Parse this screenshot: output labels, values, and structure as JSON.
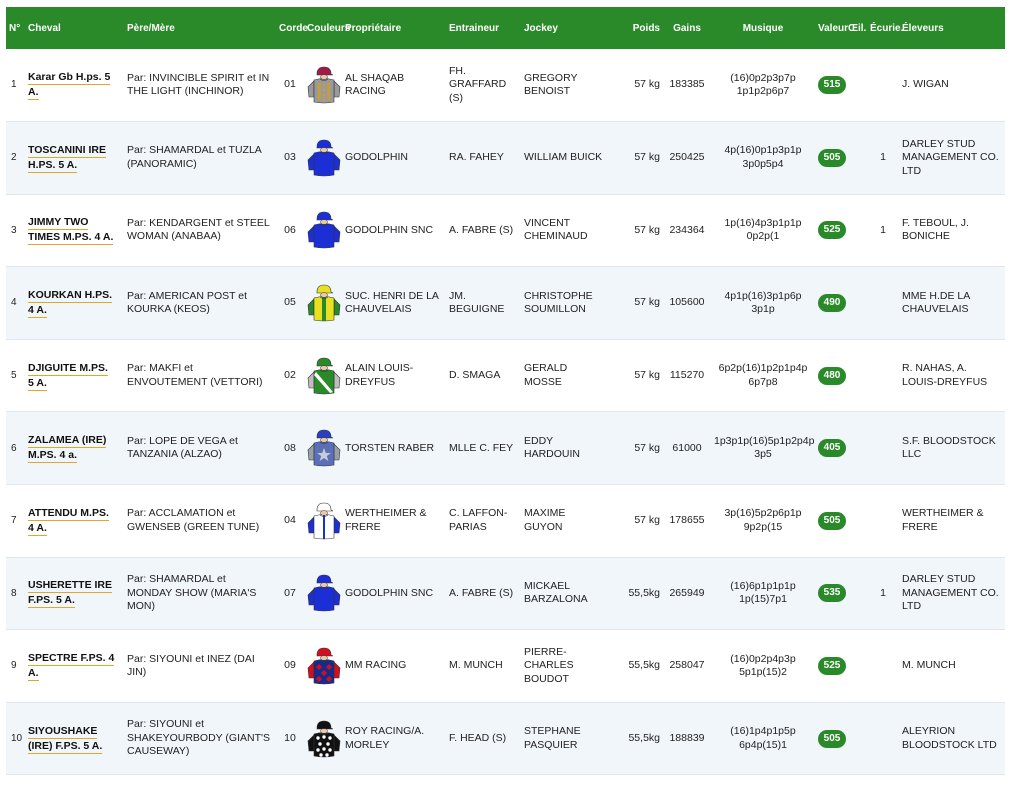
{
  "headers": {
    "num": "N°",
    "cheval": "Cheval",
    "pere_mere": "Père/Mère",
    "corde": "Corde",
    "couleurs": "Couleurs",
    "proprietaire": "Propriétaire",
    "entraineur": "Entraineur",
    "jockey": "Jockey",
    "poids": "Poids",
    "gains": "Gains",
    "musique": "Musique",
    "valeur": "Valeur",
    "oeil": "Œil.",
    "ecurie": "Écurie.",
    "eleveurs": "Éleveurs"
  },
  "runners": [
    {
      "num": "1",
      "cheval": "Karar Gb H.ps. 5 A.",
      "pere_mere": "Par: INVINCIBLE SPIRIT et IN THE LIGHT (INCHINOR)",
      "corde": "01",
      "jersey": "gold-grey-jersey",
      "cap": "#a11a4a",
      "body": "#9a9a9a",
      "sleeve": "#9a9a9a",
      "accent": "#c8a030",
      "pattern": "buttons",
      "proprietaire": "AL SHAQAB RACING",
      "entraineur": "FH. GRAFFARD (S)",
      "jockey": "GREGORY BENOIST",
      "poids": "57 kg",
      "gains": "183385",
      "musique": "(16)0p2p3p7p 1p1p2p6p7",
      "valeur": "515",
      "oeil": "",
      "ecurie": "",
      "eleveurs": "J. WIGAN"
    },
    {
      "num": "2",
      "cheval": "TOSCANINI IRE H.PS. 5 A.",
      "pere_mere": "Par: SHAMARDAL et TUZLA (PANORAMIC)",
      "corde": "03",
      "jersey": "royal-blue-jersey",
      "cap": "#1c2fd6",
      "body": "#1c2fd6",
      "sleeve": "#1c2fd6",
      "accent": "#1c2fd6",
      "pattern": "plain",
      "proprietaire": "GODOLPHIN",
      "entraineur": "RA. FAHEY",
      "jockey": "WILLIAM BUICK",
      "poids": "57 kg",
      "gains": "250425",
      "musique": "4p(16)0p1p3p1p 3p0p5p4",
      "valeur": "505",
      "oeil": "",
      "ecurie": "1",
      "eleveurs": "DARLEY STUD MANAGEMENT CO. LTD"
    },
    {
      "num": "3",
      "cheval": "JIMMY TWO TIMES M.PS. 4 A.",
      "pere_mere": "Par: KENDARGENT et STEEL WOMAN (ANABAA)",
      "corde": "06",
      "jersey": "royal-blue-jersey",
      "cap": "#1c2fd6",
      "body": "#1c2fd6",
      "sleeve": "#1c2fd6",
      "accent": "#1c2fd6",
      "pattern": "plain",
      "proprietaire": "GODOLPHIN SNC",
      "entraineur": "A. FABRE (S)",
      "jockey": "VINCENT CHEMINAUD",
      "poids": "57 kg",
      "gains": "234364",
      "musique": "1p(16)4p3p1p1p 0p2p(1",
      "valeur": "525",
      "oeil": "",
      "ecurie": "1",
      "eleveurs": "F. TEBOUL, J. BONICHE"
    },
    {
      "num": "4",
      "cheval": "KOURKAN H.PS. 4 A.",
      "pere_mere": "Par: AMERICAN POST et KOURKA (KEOS)",
      "corde": "05",
      "jersey": "yellow-green-jersey",
      "cap": "#e8e020",
      "body": "#e8e020",
      "sleeve": "#2a8a2a",
      "accent": "#2a8a2a",
      "pattern": "stripe",
      "proprietaire": "SUC. HENRI DE LA CHAUVELAIS",
      "entraineur": "JM. BEGUIGNE",
      "jockey": "CHRISTOPHE SOUMILLON",
      "poids": "57 kg",
      "gains": "105600",
      "musique": "4p1p(16)3p1p6p 3p1p",
      "valeur": "490",
      "oeil": "",
      "ecurie": "",
      "eleveurs": "MME H.DE LA CHAUVELAIS"
    },
    {
      "num": "5",
      "cheval": "DJIGUITE M.PS. 5 A.",
      "pere_mere": "Par: MAKFI et ENVOUTEMENT (VETTORI)",
      "corde": "02",
      "jersey": "green-grey-jersey",
      "cap": "#2a8a2a",
      "body": "#2a8a2a",
      "sleeve": "#bdbdbd",
      "accent": "#ffffff",
      "pattern": "sash",
      "proprietaire": "ALAIN LOUIS-DREYFUS",
      "entraineur": "D. SMAGA",
      "jockey": "GERALD MOSSE",
      "poids": "57 kg",
      "gains": "115270",
      "musique": "6p2p(16)1p2p1p4p 6p7p8",
      "valeur": "480",
      "oeil": "",
      "ecurie": "",
      "eleveurs": "R. NAHAS, A. LOUIS-DREYFUS"
    },
    {
      "num": "6",
      "cheval": "ZALAMEA (IRE) M.PS. 4 a.",
      "pere_mere": "Par: LOPE DE VEGA et TANZANIA (ALZAO)",
      "corde": "08",
      "jersey": "blue-grey-star-jersey",
      "cap": "#2a3fc0",
      "body": "#5a6fb8",
      "sleeve": "#9aa0aa",
      "accent": "#c8ccd8",
      "pattern": "star",
      "proprietaire": "TORSTEN RABER",
      "entraineur": "MLLE C. FEY",
      "jockey": "EDDY HARDOUIN",
      "poids": "57 kg",
      "gains": "61000",
      "musique": "1p3p1p(16)5p1p2p4p 3p5",
      "valeur": "405",
      "oeil": "",
      "ecurie": "",
      "eleveurs": "S.F. BLOODSTOCK LLC"
    },
    {
      "num": "7",
      "cheval": "ATTENDU M.PS. 4 A.",
      "pere_mere": "Par: ACCLAMATION et GWENSEB (GREEN TUNE)",
      "corde": "04",
      "jersey": "white-blue-jersey",
      "cap": "#ffffff",
      "body": "#ffffff",
      "sleeve": "#1c2fd6",
      "accent": "#1c2fd6",
      "pattern": "seams",
      "proprietaire": "WERTHEIMER & FRERE",
      "entraineur": "C. LAFFON-PARIAS",
      "jockey": "MAXIME GUYON",
      "poids": "57 kg",
      "gains": "178655",
      "musique": "3p(16)5p2p6p1p 9p2p(15",
      "valeur": "505",
      "oeil": "",
      "ecurie": "",
      "eleveurs": "WERTHEIMER & FRERE"
    },
    {
      "num": "8",
      "cheval": "USHERETTE IRE F.PS. 5 A.",
      "pere_mere": "Par: SHAMARDAL et MONDAY SHOW (MARIA'S MON)",
      "corde": "07",
      "jersey": "royal-blue-jersey",
      "cap": "#1c2fd6",
      "body": "#1c2fd6",
      "sleeve": "#1c2fd6",
      "accent": "#1c2fd6",
      "pattern": "plain",
      "proprietaire": "GODOLPHIN SNC",
      "entraineur": "A. FABRE (S)",
      "jockey": "MICKAEL BARZALONA",
      "poids": "55,5kg",
      "gains": "265949",
      "musique": "(16)6p1p1p1p 1p(15)7p1",
      "valeur": "535",
      "oeil": "",
      "ecurie": "1",
      "eleveurs": "DARLEY STUD MANAGEMENT CO. LTD"
    },
    {
      "num": "9",
      "cheval": "SPECTRE F.PS. 4 A.",
      "pere_mere": "Par: SIYOUNI et INEZ (DAI JIN)",
      "corde": "09",
      "jersey": "navy-red-jersey",
      "cap": "#d01020",
      "body": "#1a2a8a",
      "sleeve": "#d01020",
      "accent": "#d01020",
      "pattern": "diamonds",
      "proprietaire": "MM RACING",
      "entraineur": "M. MUNCH",
      "jockey": "PIERRE-CHARLES BOUDOT",
      "poids": "55,5kg",
      "gains": "258047",
      "musique": "(16)0p2p4p3p 5p1p(15)2",
      "valeur": "525",
      "oeil": "",
      "ecurie": "",
      "eleveurs": "M. MUNCH"
    },
    {
      "num": "10",
      "cheval": "SIYOUSHAKE (IRE) F.PS. 5 A.",
      "pere_mere": "Par: SIYOUNI et SHAKEYOURBODY (GIANT'S CAUSEWAY)",
      "corde": "10",
      "jersey": "black-white-spots-jersey",
      "cap": "#111111",
      "body": "#111111",
      "sleeve": "#111111",
      "accent": "#ffffff",
      "pattern": "spots",
      "proprietaire": "ROY RACING/A. MORLEY",
      "entraineur": "F. HEAD (S)",
      "jockey": "STEPHANE PASQUIER",
      "poids": "55,5kg",
      "gains": "188839",
      "musique": "(16)1p4p1p5p 6p4p(15)1",
      "valeur": "505",
      "oeil": "",
      "ecurie": "",
      "eleveurs": "ALEYRION BLOODSTOCK LTD"
    }
  ]
}
